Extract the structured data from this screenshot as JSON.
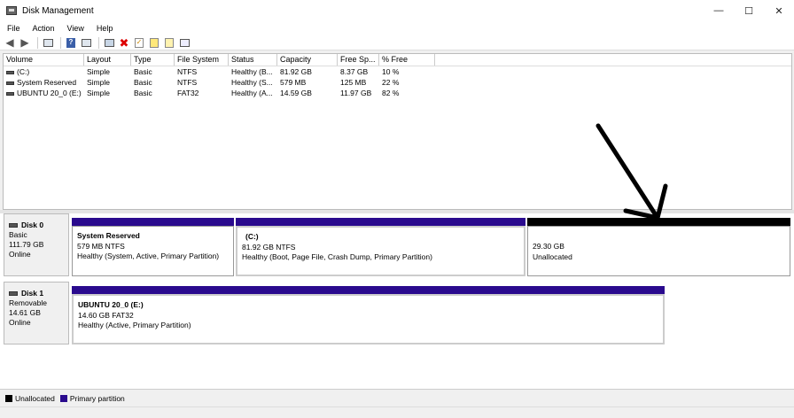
{
  "window": {
    "title": "Disk Management",
    "controls": {
      "minimize": "—",
      "maximize": "☐",
      "close": "✕"
    }
  },
  "menu": [
    "File",
    "Action",
    "View",
    "Help"
  ],
  "columns": [
    "Volume",
    "Layout",
    "Type",
    "File System",
    "Status",
    "Capacity",
    "Free Sp...",
    "% Free"
  ],
  "volumes": [
    {
      "volume": "(C:)",
      "layout": "Simple",
      "type": "Basic",
      "fs": "NTFS",
      "status": "Healthy (B...",
      "capacity": "81.92 GB",
      "free": "8.37 GB",
      "pct": "10 %"
    },
    {
      "volume": "System Reserved",
      "layout": "Simple",
      "type": "Basic",
      "fs": "NTFS",
      "status": "Healthy (S...",
      "capacity": "579 MB",
      "free": "125 MB",
      "pct": "22 %"
    },
    {
      "volume": "UBUNTU 20_0 (E:)",
      "layout": "Simple",
      "type": "Basic",
      "fs": "FAT32",
      "status": "Healthy (A...",
      "capacity": "14.59 GB",
      "free": "11.97 GB",
      "pct": "82 %"
    }
  ],
  "disks": [
    {
      "name": "Disk 0",
      "kind": "Basic",
      "size": "111.79 GB",
      "state": "Online",
      "partitions": [
        {
          "name": "System Reserved",
          "size": "579 MB NTFS",
          "status": "Healthy (System, Active, Primary Partition)",
          "kind": "primary"
        },
        {
          "name": "(C:)",
          "size": "81.92 GB NTFS",
          "status": "Healthy (Boot, Page File, Crash Dump, Primary Partition)",
          "kind": "primary"
        },
        {
          "name": "",
          "size": "29.30 GB",
          "status": "Unallocated",
          "kind": "unallocated"
        }
      ]
    },
    {
      "name": "Disk 1",
      "kind": "Removable",
      "size": "14.61 GB",
      "state": "Online",
      "partitions": [
        {
          "name": "UBUNTU 20_0 (E:)",
          "size": "14.60 GB FAT32",
          "status": "Healthy (Active, Primary Partition)",
          "kind": "primary"
        }
      ]
    }
  ],
  "legend": [
    {
      "label": "Unallocated",
      "color": "#000000"
    },
    {
      "label": "Primary partition",
      "color": "#2a0a8e"
    }
  ],
  "colors": {
    "primary": "#2a0a8e",
    "unallocated": "#000000",
    "annotation_arrow": "#000000"
  }
}
